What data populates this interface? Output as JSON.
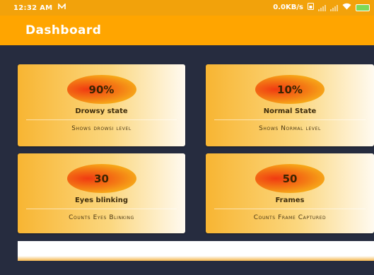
{
  "status_bar": {
    "time": "12:32 AM",
    "notification_icon": "n-notification-icon",
    "speed": "0.0KB/s",
    "icons": [
      "sim-icon",
      "signal-icon",
      "signal-icon",
      "wifi-icon",
      "battery-icon"
    ],
    "color": "#f2a20b"
  },
  "app_bar": {
    "title": "Dashboard",
    "color": "#ffa500"
  },
  "cards": [
    {
      "value": "90%",
      "title": "Drowsy state",
      "subtitle": "Shows drowsi level"
    },
    {
      "value": "10%",
      "title": "Normal State",
      "subtitle": "Shows Normal level"
    },
    {
      "value": "30",
      "title": "Eyes blinking",
      "subtitle": "Counts Eyes Blinking"
    },
    {
      "value": "50",
      "title": "Frames",
      "subtitle": "Counts Frame Captured"
    }
  ],
  "background_color": "#262c3f"
}
